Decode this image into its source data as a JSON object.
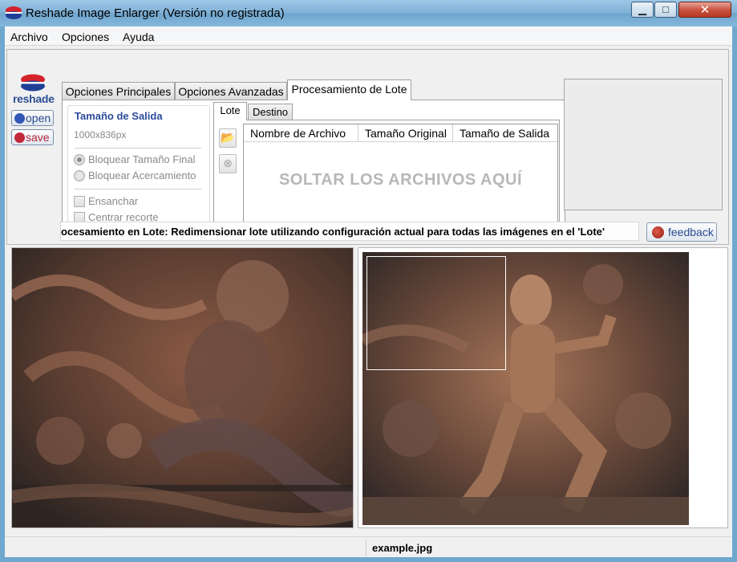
{
  "window": {
    "title": "Reshade Image Enlarger (Versión no registrada)"
  },
  "menu": [
    "Archivo",
    "Opciones",
    "Ayuda"
  ],
  "sidebar": {
    "logo_text": "reshade",
    "open_label": "open",
    "save_label": "save"
  },
  "tabs": [
    "Opciones Principales",
    "Opciones Avanzadas",
    "Procesamiento de Lote"
  ],
  "output_size": {
    "title": "Tamaño de Salida",
    "size": "1000x836px",
    "radio_lock_size": "Bloquear Tamaño Final",
    "radio_lock_zoom": "Bloquear Acercamiento",
    "check_widen": "Ensanchar",
    "check_center_crop": "Centrar recorte"
  },
  "subtabs": [
    "Lote",
    "Destino"
  ],
  "file_table": {
    "columns": [
      "Nombre de Archivo",
      "Tamaño Original",
      "Tamaño de Salida"
    ],
    "drop_hint": "SOLTAR LOS ARCHIVOS AQUÍ"
  },
  "status_message": "ocesamiento en Lote: Redimensionar lote utilizando configuración actual para todas las imágenes en el 'Lote'",
  "feedback_label": "feedback",
  "statusbar": {
    "filename": "example.jpg"
  },
  "colors": {
    "title_bar": "#7fb0d6",
    "accent_blue": "#2b4b9b",
    "close_red": "#c7503b"
  }
}
